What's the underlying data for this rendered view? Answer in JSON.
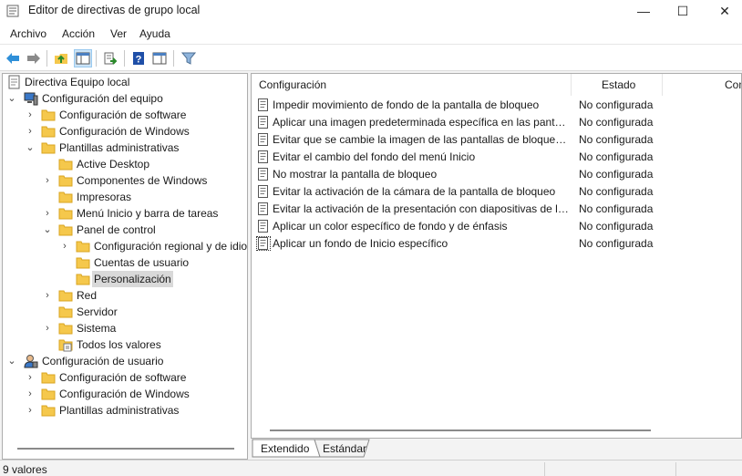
{
  "window": {
    "title": "Editor de directivas de grupo local",
    "min_glyph": "—",
    "max_glyph": "☐",
    "close_glyph": "✕"
  },
  "menu": [
    "Archivo",
    "Acción",
    "Ver",
    "Ayuda"
  ],
  "toolbar": {
    "icons": [
      "back-arrow-icon",
      "forward-arrow-icon",
      "up-folder-icon",
      "show-hide-tree-icon",
      "export-list-icon",
      "help-icon",
      "show-hide-action-pane-icon",
      "filter-icon"
    ]
  },
  "tree": {
    "root": "Directiva Equipo local",
    "computer": {
      "label": "Configuración del equipo",
      "software": "Configuración de software",
      "windows": "Configuración de Windows",
      "admin": "Plantillas administrativas",
      "active_desktop": "Active Desktop",
      "windows_components": "Componentes de Windows",
      "printers": "Impresoras",
      "start_menu": "Menú Inicio y barra de tareas",
      "control_panel": "Panel de control",
      "regional": "Configuración regional y de idioma",
      "user_accounts": "Cuentas de usuario",
      "personalization": "Personalización",
      "network": "Red",
      "server": "Servidor",
      "system": "Sistema",
      "all_settings": "Todos los valores"
    },
    "user": {
      "label": "Configuración de usuario",
      "software": "Configuración de software",
      "windows": "Configuración de Windows",
      "admin": "Plantillas administrativas"
    }
  },
  "list": {
    "columns": {
      "setting": "Configuración",
      "state": "Estado",
      "comment": "Comentario"
    },
    "rows": [
      {
        "name": "Impedir movimiento de fondo de la pantalla de bloqueo",
        "state": "No configurada"
      },
      {
        "name": "Aplicar una imagen predeterminada específica en las pantallas de bloqueo",
        "state": "No configurada"
      },
      {
        "name": "Evitar que se cambie la imagen de las pantallas de bloqueo y de inicio",
        "state": "No configurada"
      },
      {
        "name": "Evitar el cambio del fondo del menú Inicio",
        "state": "No configurada"
      },
      {
        "name": "No mostrar la pantalla de bloqueo",
        "state": "No configurada"
      },
      {
        "name": "Evitar la activación de la cámara de la pantalla de bloqueo",
        "state": "No configurada"
      },
      {
        "name": "Evitar la activación de la presentación con diapositivas de la pantalla de bloqueo",
        "state": "No configurada"
      },
      {
        "name": "Aplicar un color específico de fondo y de énfasis",
        "state": "No configurada"
      },
      {
        "name": "Aplicar un fondo de Inicio específico",
        "state": "No configurada"
      }
    ]
  },
  "tabs": {
    "extended": "Extendido",
    "standard": "Estándar"
  },
  "status": {
    "count": "9 valores"
  },
  "colors": {
    "folder": "#f5c84c",
    "selection": "#d9d9d9",
    "toolbar_active": "#cce4f7"
  }
}
